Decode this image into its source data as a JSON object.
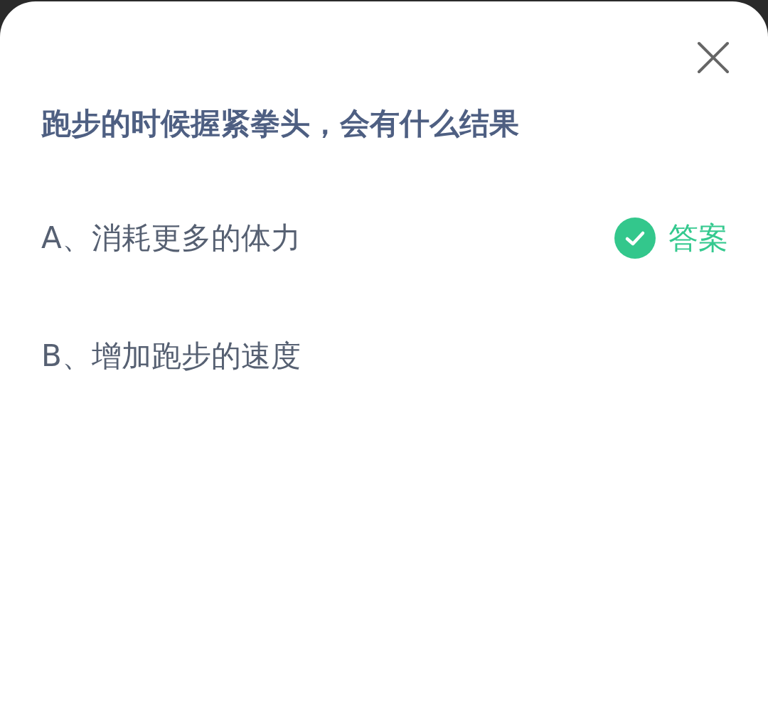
{
  "question": "跑步的时候握紧拳头，会有什么结果",
  "options": [
    {
      "label": "A、消耗更多的体力",
      "correct": true,
      "badge": "答案"
    },
    {
      "label": "B、增加跑步的速度",
      "correct": false
    }
  ]
}
